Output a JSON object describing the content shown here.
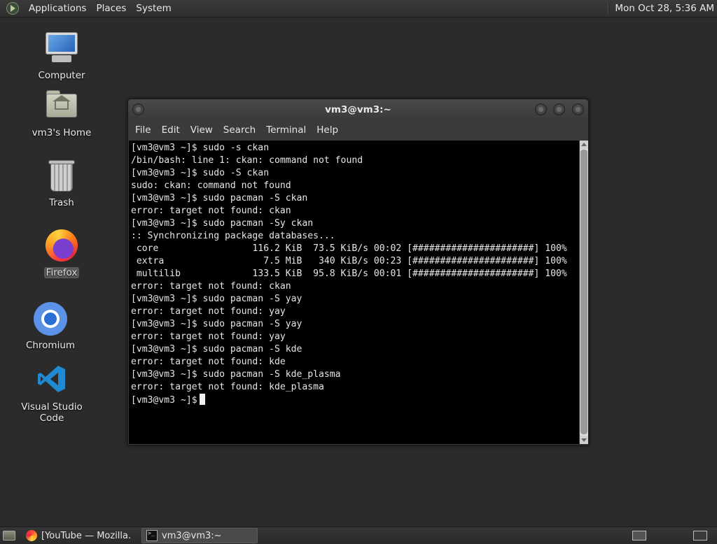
{
  "top_panel": {
    "menus": [
      "Applications",
      "Places",
      "System"
    ],
    "clock": "Mon Oct 28,  5:36 AM"
  },
  "desktop_icons": [
    {
      "label": "Computer",
      "icon": "computer-icon"
    },
    {
      "label": "vm3's Home",
      "icon": "home-folder-icon"
    },
    {
      "label": "Trash",
      "icon": "trash-icon"
    },
    {
      "label": "Firefox",
      "icon": "firefox-icon",
      "selected": true
    },
    {
      "label": "Chromium",
      "icon": "chromium-icon"
    },
    {
      "label": "Visual Studio Code",
      "icon": "vscode-icon"
    }
  ],
  "terminal_window": {
    "title": "vm3@vm3:~",
    "menus": [
      "File",
      "Edit",
      "View",
      "Search",
      "Terminal",
      "Help"
    ],
    "lines": [
      "[vm3@vm3 ~]$ sudo -s ckan",
      "/bin/bash: line 1: ckan: command not found",
      "[vm3@vm3 ~]$ sudo -S ckan",
      "sudo: ckan: command not found",
      "[vm3@vm3 ~]$ sudo pacman -S ckan",
      "error: target not found: ckan",
      "[vm3@vm3 ~]$ sudo pacman -Sy ckan",
      ":: Synchronizing package databases...",
      " core                 116.2 KiB  73.5 KiB/s 00:02 [######################] 100%",
      " extra                  7.5 MiB   340 KiB/s 00:23 [######################] 100%",
      " multilib             133.5 KiB  95.8 KiB/s 00:01 [######################] 100%",
      "error: target not found: ckan",
      "[vm3@vm3 ~]$ sudo pacman -S yay",
      "error: target not found: yay",
      "[vm3@vm3 ~]$ sudo pacman -S yay",
      "error: target not found: yay",
      "[vm3@vm3 ~]$ sudo pacman -S kde",
      "error: target not found: kde",
      "[vm3@vm3 ~]$ sudo pacman -S kde_plasma",
      "error: target not found: kde_plasma"
    ],
    "prompt": "[vm3@vm3 ~]$"
  },
  "taskbar": {
    "tasks": [
      {
        "label": "[YouTube — Mozilla...",
        "icon": "firefox-icon",
        "active": false
      },
      {
        "label": "vm3@vm3:~",
        "icon": "terminal-icon",
        "active": true
      }
    ]
  }
}
